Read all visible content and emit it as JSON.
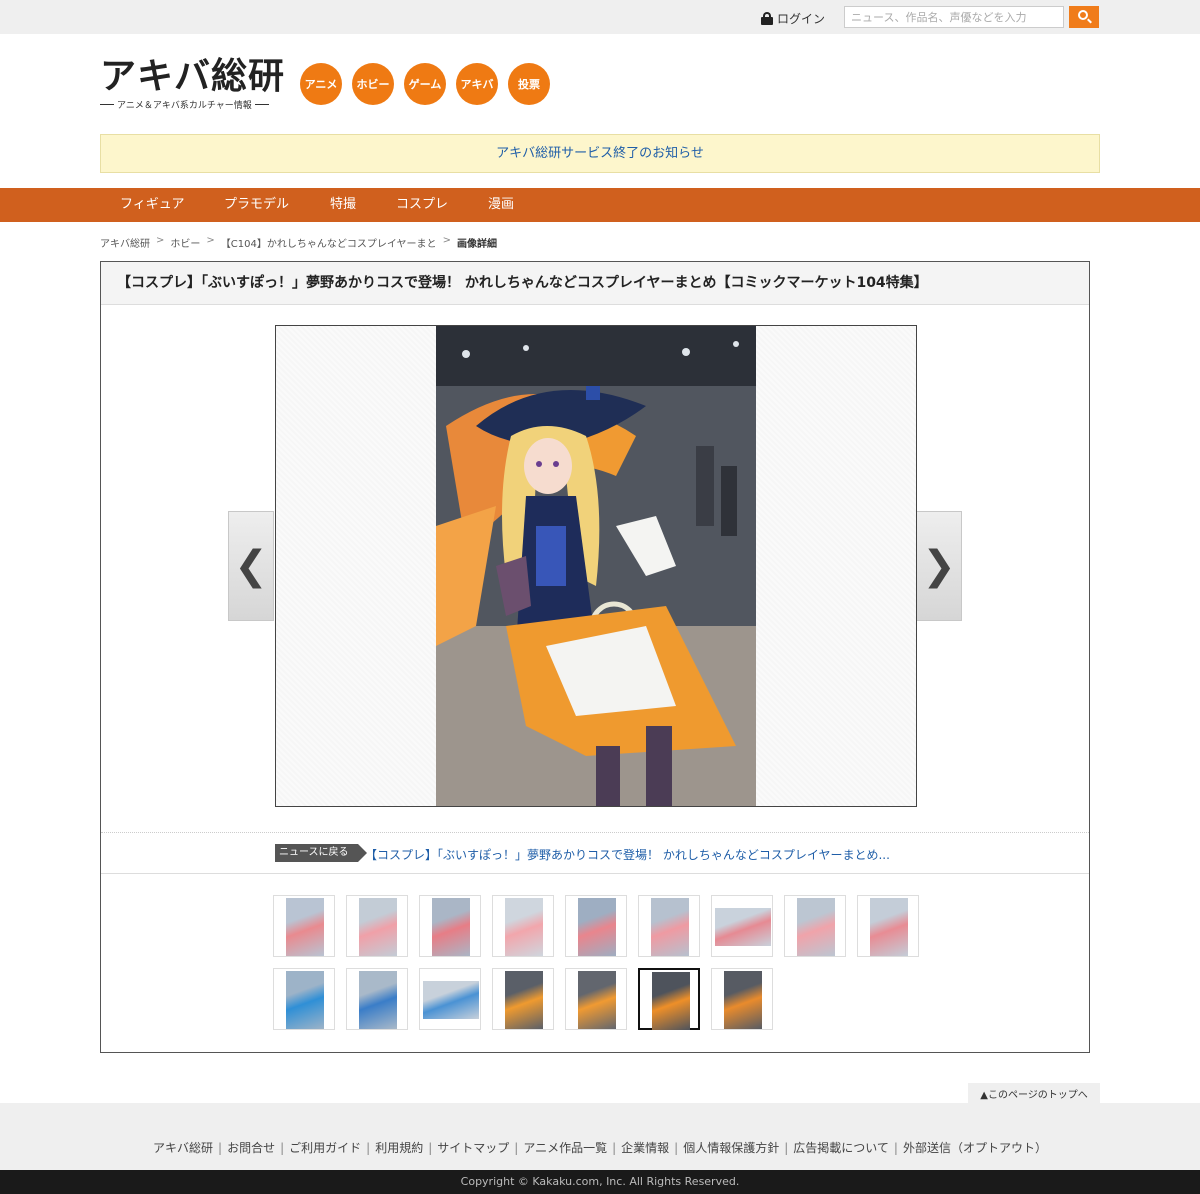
{
  "topbar": {
    "login_label": "ログイン",
    "search_placeholder": "ニュース、作品名、声優などを入力"
  },
  "header": {
    "logo_title": "アキバ総研",
    "logo_subtitle": "アニメ＆アキバ系カルチャー情報",
    "categories": [
      "アニメ",
      "ホビー",
      "ゲーム",
      "アキバ",
      "投票"
    ]
  },
  "notice": {
    "text": "アキバ総研サービス終了のお知らせ"
  },
  "nav": {
    "items": [
      "フィギュア",
      "プラモデル",
      "特撮",
      "コスプレ",
      "漫画"
    ]
  },
  "breadcrumb": {
    "items": [
      "アキバ総研",
      "ホビー",
      "【C104】かれしちゃんなどコスプレイヤーまと"
    ],
    "current": "画像詳細"
  },
  "article": {
    "title": "【コスプレ】「ぶいすぽっ！」夢野あかりコスで登場！ かれしちゃんなどコスプレイヤーまとめ【コミックマーケット104特集】"
  },
  "viewer": {
    "prev_glyph": "❮",
    "next_glyph": "❯"
  },
  "back": {
    "badge": "ニュースに戻る",
    "link_text": "【コスプレ】「ぶいすぽっ！」夢野あかりコスで登場！ かれしちゃんなどコスプレイヤーまとめ..."
  },
  "thumbnails": {
    "count": 16,
    "selected_index": 14
  },
  "pagetop": {
    "label": "▲このページのトップへ"
  },
  "footer": {
    "links": [
      "アキバ総研",
      "お問合せ",
      "ご利用ガイド",
      "利用規約",
      "サイトマップ",
      "アニメ作品一覧",
      "企業情報",
      "個人情報保護方針",
      "広告掲載について",
      "外部送信（オプトアウト）"
    ],
    "copyright": "Copyright © Kakaku.com, Inc. All Rights Reserved."
  },
  "colors": {
    "accent_orange": "#ef7a13",
    "nav_bar": "#d0601e",
    "notice_bg": "#fdf6cc",
    "link_blue": "#1f5ea8"
  }
}
